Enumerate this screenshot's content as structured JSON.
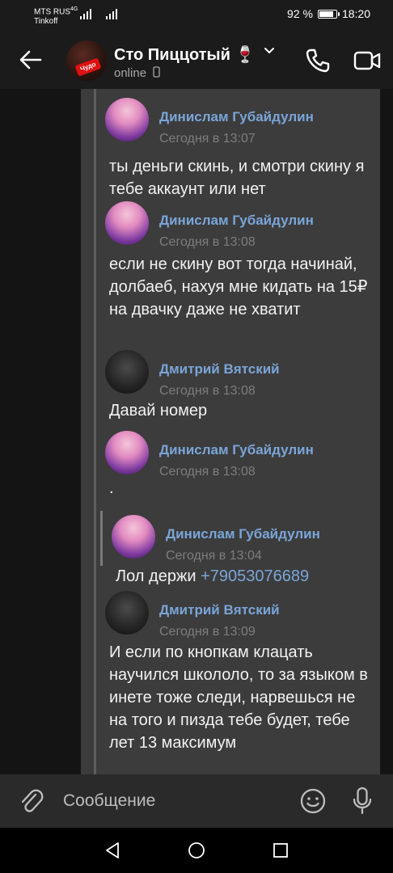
{
  "status_bar": {
    "carrier_1": "MTS RUS",
    "network_type": "4G",
    "carrier_2": "Tinkoff",
    "battery_percent": "92 %",
    "battery_level": 0.92,
    "time": "18:20"
  },
  "header": {
    "title": "Сто Пиццотый 🍷",
    "status": "online",
    "avatar_badge": "Чудо"
  },
  "messages": [
    {
      "author": "Динислам Губайдулин",
      "time": "Сегодня в 13:07",
      "text": "ты деньги скинь, и смотри скину я тебе аккаунт или нет"
    },
    {
      "author": "Динислам Губайдулин",
      "time": "Сегодня в 13:08",
      "text": "если не скину вот тогда начинай, долбаеб, нахуя мне кидать на 15₽ на двачку даже не хватит"
    },
    {
      "author": "Дмитрий Вятский",
      "time": "Сегодня в 13:08",
      "text": "Давай номер"
    },
    {
      "author": "Динислам Губайдулин",
      "time": "Сегодня в 13:08",
      "text": "."
    },
    {
      "author": "Динислам Губайдулин",
      "time": "Сегодня в 13:04",
      "text_prefix": "Лол держи ",
      "link": "+79053076689"
    },
    {
      "author": "Дмитрий Вятский",
      "time": "Сегодня в 13:09",
      "text": "И если по кнопкам клацать научился школоло, то за языком в инете тоже следи, нарвешься не на того и пизда тебе будет, тебе лет 13 максимум"
    }
  ],
  "composer": {
    "placeholder": "Сообщение"
  },
  "icons": [
    "back-arrow-icon",
    "phone-icon",
    "video-camera-icon",
    "phone-small-icon",
    "attach-icon",
    "emoji-icon",
    "microphone-icon",
    "nav-back-icon",
    "nav-home-icon",
    "nav-recents-icon"
  ],
  "colors": {
    "author_name": "#7aa5d8",
    "link": "#7aa5d8",
    "background": "#1b1b1b",
    "message_panel": "#3c3c3c"
  }
}
